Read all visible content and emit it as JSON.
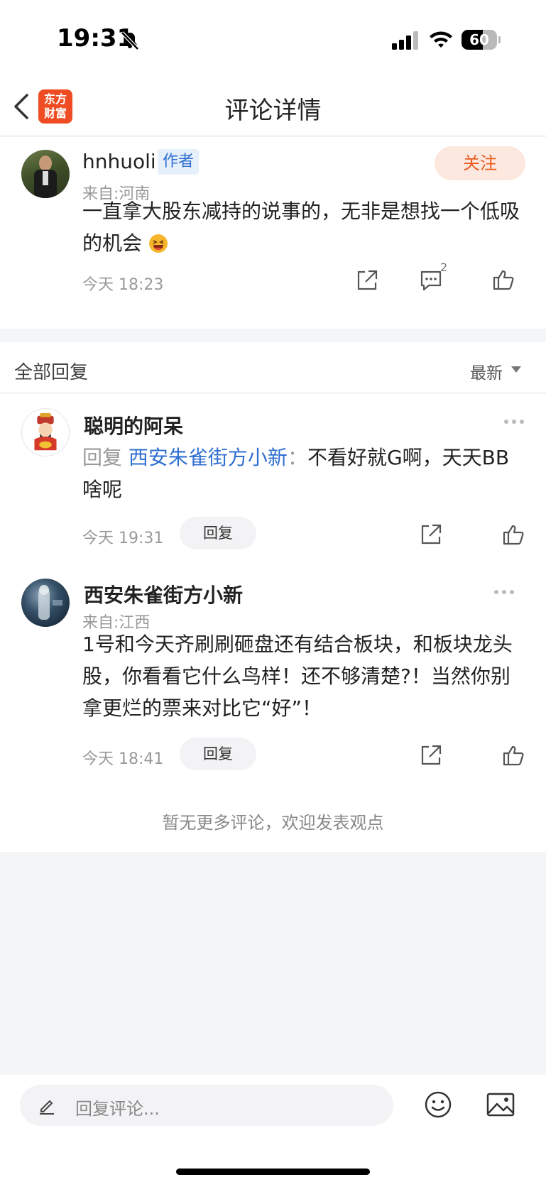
{
  "status_bar": {
    "time": "19:31",
    "battery": "60",
    "battery_level": 0.6
  },
  "nav": {
    "logo_line1": "东方",
    "logo_line2": "财富",
    "title": "评论详情"
  },
  "main_comment": {
    "username": "hnhuoli",
    "badge": "作者",
    "follow_label": "关注",
    "location": "来自:河南",
    "text": "一直拿大股东减持的说事的，无非是想找一个低吸的机会",
    "time": "今天 18:23",
    "reply_count": "2"
  },
  "replies_header": {
    "title": "全部回复",
    "sort_label": "最新"
  },
  "replies": [
    {
      "username": "聪明的阿呆",
      "reply_prefix": "回复",
      "reply_target": "西安朱雀街方小新",
      "separator": "：",
      "text": "不看好就G啊，天天BB啥呢",
      "time": "今天 19:31",
      "reply_label": "回复"
    },
    {
      "username": "西安朱雀街方小新",
      "location": "来自:江西",
      "text": "1号和今天齐刷刷砸盘还有结合板块，和板块龙头股，你看看它什么鸟样！还不够清楚?！当然你别拿更烂的票来对比它“好”！",
      "time": "今天 18:41",
      "reply_label": "回复"
    }
  ],
  "footer_note": "暂无更多评论，欢迎发表观点",
  "input": {
    "placeholder": "回复评论..."
  },
  "colors": {
    "accent_orange": "#ea5b1c",
    "link_blue": "#2f6fd1",
    "logo_red": "#ef4c23"
  }
}
